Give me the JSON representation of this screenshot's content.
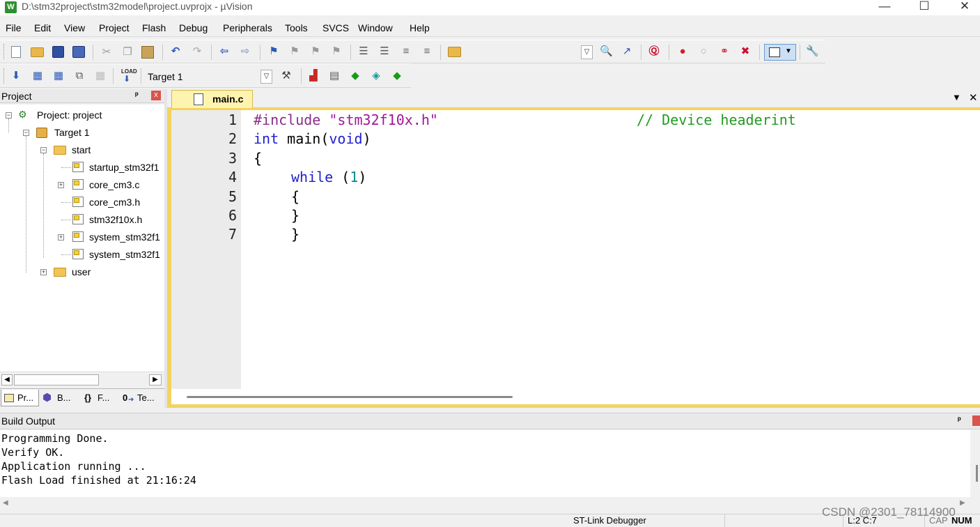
{
  "window": {
    "icon_label": "W",
    "title": "D:\\stm32project\\stm32model\\project.uvprojx - µVision",
    "minimize": "—",
    "maximize": "☐",
    "close": "✕"
  },
  "menu": [
    "File",
    "Edit",
    "View",
    "Project",
    "Flash",
    "Debug",
    "Peripherals",
    "Tools",
    "SVCS",
    "Window",
    "Help"
  ],
  "toolbar2": {
    "target_select": "Target 1",
    "load_label": "LOAD"
  },
  "project_panel": {
    "title": "Project",
    "pin": "ᵖ",
    "close": "x",
    "tree": {
      "root": "Project: project",
      "target": "Target 1",
      "group_start": "start",
      "files": [
        "startup_stm32f1",
        "core_cm3.c",
        "core_cm3.h",
        "stm32f10x.h",
        "system_stm32f1",
        "system_stm32f1"
      ],
      "group_user": "user"
    },
    "tabs": [
      "Pr...",
      "B...",
      "F...",
      "Te..."
    ]
  },
  "editor": {
    "tab_label": "main.c",
    "line_numbers": [
      "1",
      "2",
      "3",
      "4",
      "5",
      "6",
      "7"
    ],
    "lines": {
      "l1_directive": "#include",
      "l1_string": "\"stm32f10x.h\"",
      "l1_comment": "// Device headerint",
      "l2_kw": "int",
      "l2_name": "main",
      "l2_paren_open": "(",
      "l2_void": "void",
      "l2_paren_close": ")",
      "l3": "{",
      "l4_kw": "while",
      "l4_paren_open": "(",
      "l4_num": "1",
      "l4_paren_close": ")",
      "l5": "{",
      "l6": "}",
      "l7": "}"
    }
  },
  "build_output": {
    "title": "Build Output",
    "lines": [
      "Programming Done.",
      "Verify OK.",
      "Application running ...",
      "Flash Load finished at 21:16:24"
    ]
  },
  "status": {
    "debugger": "ST-Link Debugger",
    "position": "L:2 C:7",
    "caps": "CAP",
    "num": "NUM",
    "watermark": "CSDN @2301_78114900"
  },
  "colors": {
    "keyword": "#1f1fcf",
    "preprocessor": "#8a2d8a",
    "string": "#a0159a",
    "comment": "#219b21",
    "number": "#0a8a8a",
    "editor_frame": "#f4d35e"
  }
}
